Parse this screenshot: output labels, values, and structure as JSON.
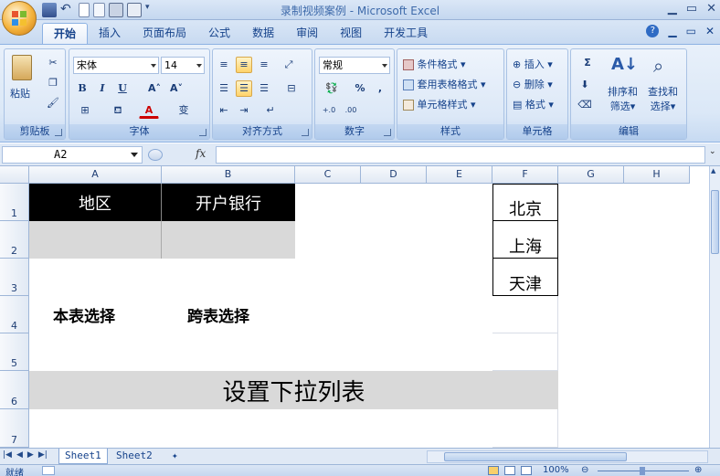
{
  "window": {
    "title": "录制视频案例 - Microsoft Excel"
  },
  "tabs": [
    "开始",
    "插入",
    "页面布局",
    "公式",
    "数据",
    "审阅",
    "视图",
    "开发工具"
  ],
  "active_tab": "开始",
  "ribbon": {
    "clipboard": {
      "paste": "粘贴",
      "label": "剪贴板"
    },
    "font": {
      "name": "宋体",
      "size": "14",
      "label": "字体",
      "bold": "B",
      "italic": "I",
      "underline": "U",
      "grow": "A˄",
      "shrink": "A˅",
      "color_a": "A",
      "phonetic": "变"
    },
    "alignment": {
      "label": "对齐方式"
    },
    "number": {
      "format": "常规",
      "label": "数字",
      "percent": "%",
      "comma": ",",
      "inc_dec": "+.0 .00",
      "dec_dec": ".00 →.0"
    },
    "styles": {
      "label": "样式",
      "conditional": "条件格式",
      "table": "套用表格格式",
      "cell": "单元格样式"
    },
    "cells": {
      "label": "单元格",
      "insert": "插入",
      "delete": "删除",
      "format": "格式"
    },
    "editing": {
      "label": "编辑",
      "sum": "Σ",
      "sort": "排序和",
      "sort2": "筛选",
      "find": "查找和",
      "find2": "选择"
    }
  },
  "formula_bar": {
    "name_box": "A2",
    "fx": "fx",
    "value": ""
  },
  "columns": [
    "A",
    "B",
    "C",
    "D",
    "E",
    "F",
    "G",
    "H"
  ],
  "rows": [
    "1",
    "2",
    "3",
    "4",
    "5",
    "6",
    "7"
  ],
  "cells": {
    "A1": "地区",
    "B1": "开户银行",
    "F1": "北京",
    "F2": "上海",
    "F3": "天津",
    "A4": "本表选择",
    "B4": "跨表选择",
    "A6": "设置下拉列表"
  },
  "sheets": [
    "Sheet1",
    "Sheet2"
  ],
  "active_sheet": "Sheet1",
  "status": {
    "mode": "就绪",
    "zoom": "100%"
  },
  "colors": {
    "header_fill": "#000000",
    "header_text": "#ffffff",
    "gray_fill": "#d9d9d9"
  }
}
